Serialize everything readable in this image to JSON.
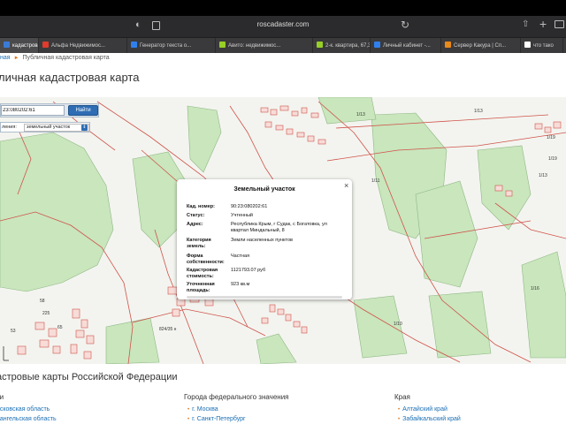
{
  "browser": {
    "url": "roscadaster.com",
    "tabs": [
      {
        "label": "кадастровая...",
        "active": true,
        "color": "#3b7bd6"
      },
      {
        "label": "Альфа Недвижимос...",
        "active": false,
        "color": "#e03b2c"
      },
      {
        "label": "Генератор текста о...",
        "active": false,
        "color": "#2f80ed"
      },
      {
        "label": "Авито: недвижимос...",
        "active": false,
        "color": "#97cf26"
      },
      {
        "label": "2-к. квартира, 67,3...",
        "active": false,
        "color": "#97cf26"
      },
      {
        "label": "Личный кабинет -...",
        "active": false,
        "color": "#2f80ed"
      },
      {
        "label": "Сервер Какура | Сп...",
        "active": false,
        "color": "#e88a1a"
      },
      {
        "label": "что тако",
        "active": false,
        "color": "#ffffff"
      }
    ]
  },
  "breadcrumb": {
    "home": "ная",
    "current": "Публичная кадастровая карта"
  },
  "page_title": "личная кадастровая карта",
  "map": {
    "search": {
      "value": "23:080202:61",
      "button": "Найти"
    },
    "filter": {
      "label": "ления:",
      "value": "земельный участок"
    },
    "plot_labels": [
      {
        "text": "1/13"
      },
      {
        "text": "1/13"
      },
      {
        "text": "1/19"
      },
      {
        "text": "1/19"
      },
      {
        "text": "1/11"
      },
      {
        "text": "1/13"
      },
      {
        "text": "1/16"
      },
      {
        "text": "1/15"
      },
      {
        "text": "1/10"
      },
      {
        "text": "58"
      },
      {
        "text": "225"
      },
      {
        "text": "65"
      },
      {
        "text": "53"
      },
      {
        "text": "824/35 н"
      }
    ],
    "popup": {
      "title": "Земельный участок",
      "rows": [
        {
          "label": "Кад. номер:",
          "value": "90:23:080202:61"
        },
        {
          "label": "Статус:",
          "value": "Учтенный"
        },
        {
          "label": "Адрес:",
          "value": "Республика Крым, г Судак, с Богатовка, ул квартал Миндальный, 8"
        },
        {
          "label": "Категория земель:",
          "value": "Земли населенных пунктов"
        },
        {
          "label": "Форма собственности:",
          "value": "Частная"
        },
        {
          "label": "Кадастровая стоимость:",
          "value": "1121793.07 руб"
        },
        {
          "label": "Уточненная площадь:",
          "value": "923 кв.м"
        }
      ]
    }
  },
  "catalog": {
    "title": "астровые карты Российской Федерации",
    "columns": [
      {
        "heading": "ти",
        "links": [
          "осковская область",
          "рангельская область"
        ]
      },
      {
        "heading": "Города федерального значения",
        "links": [
          "г. Москва",
          "г. Санкт-Петербург"
        ]
      },
      {
        "heading": "Края",
        "links": [
          "Алтайский край",
          "Забайкальский край"
        ]
      }
    ]
  },
  "colors": {
    "accent": "#2e6db4",
    "link": "#1a6fb5",
    "plot_green": "#c9e6bd",
    "boundary": "#d0524a"
  }
}
